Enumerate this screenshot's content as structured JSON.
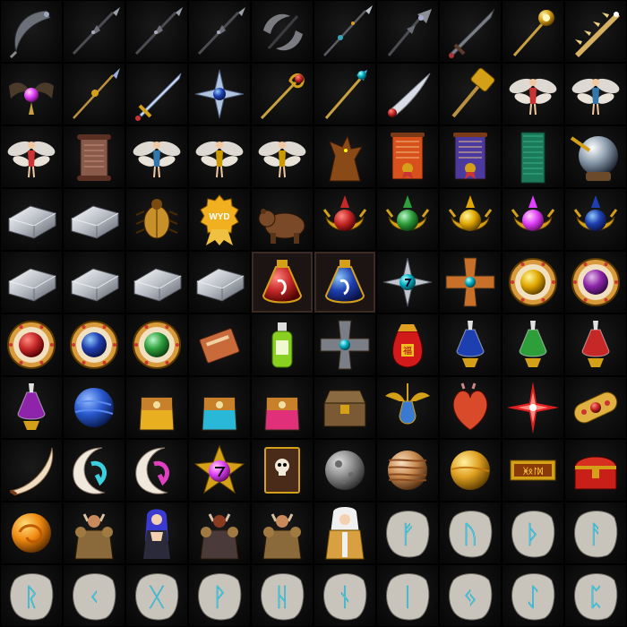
{
  "grid": {
    "columns": 10,
    "rows": 10,
    "background": "#000000",
    "items": [
      {
        "icon": "crescent-bone-scythe-icon",
        "framed": false
      },
      {
        "icon": "ornate-dark-spear-icon",
        "framed": false
      },
      {
        "icon": "ornate-dark-spear-icon",
        "framed": false
      },
      {
        "icon": "ornate-dark-spear-icon",
        "framed": false
      },
      {
        "icon": "double-crescent-blade-icon",
        "framed": false
      },
      {
        "icon": "jeweled-lance-icon",
        "framed": false
      },
      {
        "icon": "spiked-halberd-icon",
        "framed": false
      },
      {
        "icon": "great-dark-sword-icon",
        "framed": false
      },
      {
        "icon": "golden-wand-icon",
        "framed": false
      },
      {
        "icon": "spiked-golden-blade-icon",
        "framed": false
      },
      {
        "icon": "bat-wing-amulet-icon",
        "framed": false
      },
      {
        "icon": "golden-spear-icon",
        "framed": false
      },
      {
        "icon": "jeweled-long-sword-icon",
        "framed": false
      },
      {
        "icon": "star-compass-emblem-icon",
        "framed": false
      },
      {
        "icon": "golden-scepter-icon",
        "framed": false
      },
      {
        "icon": "jeweled-staff-icon",
        "framed": false
      },
      {
        "icon": "curved-sabre-icon",
        "framed": false
      },
      {
        "icon": "golden-hammer-icon",
        "framed": false
      },
      {
        "icon": "pink-fairy-icon",
        "framed": false
      },
      {
        "icon": "blue-fairy-icon",
        "framed": false
      },
      {
        "icon": "pink-fairy-icon",
        "framed": false
      },
      {
        "icon": "ancient-scroll-icon",
        "framed": false
      },
      {
        "icon": "blue-fairy-icon",
        "framed": false
      },
      {
        "icon": "gold-fairy-icon",
        "framed": false
      },
      {
        "icon": "gold-fairy-icon",
        "framed": false
      },
      {
        "icon": "dragon-statue-icon",
        "framed": false
      },
      {
        "icon": "orange-certificate-icon",
        "framed": false
      },
      {
        "icon": "purple-certificate-icon",
        "framed": false
      },
      {
        "icon": "green-banner-icon",
        "framed": false
      },
      {
        "icon": "crystal-ball-horn-icon",
        "framed": false
      },
      {
        "icon": "silver-ingot-icon",
        "framed": false
      },
      {
        "icon": "silver-ingot-icon",
        "framed": false
      },
      {
        "icon": "golden-beetle-icon",
        "framed": false
      },
      {
        "icon": "gold-award-medal-icon",
        "framed": false,
        "label": "WYD"
      },
      {
        "icon": "brown-bear-icon",
        "framed": false
      },
      {
        "icon": "red-orb-crest-icon",
        "framed": false
      },
      {
        "icon": "green-orb-crest-icon",
        "framed": false
      },
      {
        "icon": "yellow-orb-crest-icon",
        "framed": false
      },
      {
        "icon": "pink-orb-crest-icon",
        "framed": false
      },
      {
        "icon": "blue-orb-crest-icon",
        "framed": false
      },
      {
        "icon": "silver-ingot-icon",
        "framed": false
      },
      {
        "icon": "silver-ingot-icon",
        "framed": false
      },
      {
        "icon": "silver-ingot-icon",
        "framed": false
      },
      {
        "icon": "silver-ingot-icon",
        "framed": false
      },
      {
        "icon": "red-potion-icon",
        "framed": true
      },
      {
        "icon": "blue-potion-icon",
        "framed": true
      },
      {
        "icon": "teal-star-seal-icon",
        "framed": false
      },
      {
        "icon": "jeweled-cross-icon",
        "framed": false
      },
      {
        "icon": "yellow-gem-ring-icon",
        "framed": false
      },
      {
        "icon": "purple-gem-ring-icon",
        "framed": false
      },
      {
        "icon": "red-gem-ring-icon",
        "framed": false
      },
      {
        "icon": "blue-gem-ring-icon",
        "framed": false
      },
      {
        "icon": "green-gem-ring-icon",
        "framed": false
      },
      {
        "icon": "small-book-icon",
        "framed": false
      },
      {
        "icon": "green-bottle-icon",
        "framed": false
      },
      {
        "icon": "ornate-cross-icon",
        "framed": false
      },
      {
        "icon": "red-fortune-bag-icon",
        "framed": false
      },
      {
        "icon": "blue-elixir-icon",
        "framed": false
      },
      {
        "icon": "green-elixir-icon",
        "framed": false
      },
      {
        "icon": "red-elixir-icon",
        "framed": false
      },
      {
        "icon": "purple-elixir-icon",
        "framed": false
      },
      {
        "icon": "blue-planet-icon",
        "framed": false
      },
      {
        "icon": "yellow-pouch-icon",
        "framed": false
      },
      {
        "icon": "cyan-pouch-icon",
        "framed": false
      },
      {
        "icon": "pink-pouch-icon",
        "framed": false
      },
      {
        "icon": "treasure-chest-icon",
        "framed": false
      },
      {
        "icon": "winged-vase-icon",
        "framed": false
      },
      {
        "icon": "heart-organ-icon",
        "framed": false
      },
      {
        "icon": "red-star-icon",
        "framed": false
      },
      {
        "icon": "golden-capsule-icon",
        "framed": false
      },
      {
        "icon": "ivory-horn-icon",
        "framed": false
      },
      {
        "icon": "teal-moon-rune-icon",
        "framed": false
      },
      {
        "icon": "pink-moon-rune-icon",
        "framed": false
      },
      {
        "icon": "magenta-star-rune-icon",
        "framed": false
      },
      {
        "icon": "skull-tome-icon",
        "framed": false
      },
      {
        "icon": "grey-moon-icon",
        "framed": false
      },
      {
        "icon": "jupiter-planet-icon",
        "framed": false
      },
      {
        "icon": "golden-planet-icon",
        "framed": false
      },
      {
        "icon": "gold-ticket-icon",
        "framed": false
      },
      {
        "icon": "red-treasure-chest-icon",
        "framed": false
      },
      {
        "icon": "orange-swirl-orb-icon",
        "framed": false
      },
      {
        "icon": "horned-warrior-icon",
        "framed": false
      },
      {
        "icon": "blue-haired-sorceress-icon",
        "framed": false
      },
      {
        "icon": "demon-knight-icon",
        "framed": false
      },
      {
        "icon": "horned-warrior-icon",
        "framed": false
      },
      {
        "icon": "white-haired-priestess-icon",
        "framed": false
      },
      {
        "icon": "rune-stone-icon",
        "framed": false,
        "glyph": "ᚠ"
      },
      {
        "icon": "rune-stone-icon",
        "framed": false,
        "glyph": "ᚢ"
      },
      {
        "icon": "rune-stone-icon",
        "framed": false,
        "glyph": "ᚦ"
      },
      {
        "icon": "rune-stone-icon",
        "framed": false,
        "glyph": "ᚨ"
      },
      {
        "icon": "rune-stone-icon",
        "framed": false,
        "glyph": "ᚱ"
      },
      {
        "icon": "rune-stone-icon",
        "framed": false,
        "glyph": "ᚲ"
      },
      {
        "icon": "rune-stone-icon",
        "framed": false,
        "glyph": "ᚷ"
      },
      {
        "icon": "rune-stone-icon",
        "framed": false,
        "glyph": "ᚹ"
      },
      {
        "icon": "rune-stone-icon",
        "framed": false,
        "glyph": "ᚺ"
      },
      {
        "icon": "rune-stone-icon",
        "framed": false,
        "glyph": "ᚾ"
      },
      {
        "icon": "rune-stone-icon",
        "framed": false,
        "glyph": "ᛁ"
      },
      {
        "icon": "rune-stone-icon",
        "framed": false,
        "glyph": "ᛃ"
      },
      {
        "icon": "rune-stone-icon",
        "framed": false,
        "glyph": "ᛇ"
      },
      {
        "icon": "rune-stone-icon",
        "framed": false,
        "glyph": "ᛈ"
      }
    ]
  }
}
